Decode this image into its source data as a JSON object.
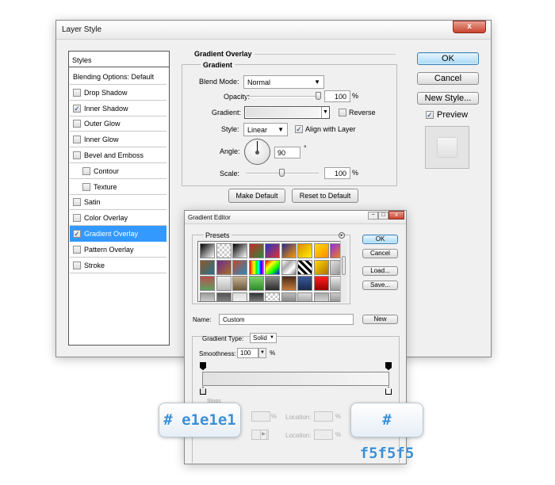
{
  "layer_style": {
    "title": "Layer Style",
    "close": "x",
    "styles_header": "Styles",
    "items": [
      {
        "label": "Blending Options: Default",
        "checkbox": false,
        "checked": false,
        "active": false
      },
      {
        "label": "Drop Shadow",
        "checkbox": true,
        "checked": false,
        "active": false
      },
      {
        "label": "Inner Shadow",
        "checkbox": true,
        "checked": true,
        "active": false
      },
      {
        "label": "Outer Glow",
        "checkbox": true,
        "checked": false,
        "active": false
      },
      {
        "label": "Inner Glow",
        "checkbox": true,
        "checked": false,
        "active": false
      },
      {
        "label": "Bevel and Emboss",
        "checkbox": true,
        "checked": false,
        "active": false
      },
      {
        "label": "Contour",
        "checkbox": true,
        "checked": false,
        "active": false,
        "indent": true
      },
      {
        "label": "Texture",
        "checkbox": true,
        "checked": false,
        "active": false,
        "indent": true
      },
      {
        "label": "Satin",
        "checkbox": true,
        "checked": false,
        "active": false
      },
      {
        "label": "Color Overlay",
        "checkbox": true,
        "checked": false,
        "active": false
      },
      {
        "label": "Gradient Overlay",
        "checkbox": true,
        "checked": true,
        "active": true
      },
      {
        "label": "Pattern Overlay",
        "checkbox": true,
        "checked": false,
        "active": false
      },
      {
        "label": "Stroke",
        "checkbox": true,
        "checked": false,
        "active": false
      }
    ],
    "section_title": "Gradient Overlay",
    "group_title": "Gradient",
    "blend_mode_label": "Blend Mode:",
    "blend_mode_value": "Normal",
    "opacity_label": "Opacity:",
    "opacity_value": "100",
    "opacity_level": 1.0,
    "percent": "%",
    "gradient_label": "Gradient:",
    "reverse_label": "Reverse",
    "reverse_checked": false,
    "style_label": "Style:",
    "style_value": "Linear",
    "align_label": "Align with Layer",
    "align_checked": true,
    "angle_label": "Angle:",
    "angle_value": "90",
    "degree": "°",
    "scale_label": "Scale:",
    "scale_value": "100",
    "scale_level": 0.5,
    "make_default": "Make Default",
    "reset_default": "Reset to Default",
    "ok": "OK",
    "cancel": "Cancel",
    "new_style": "New Style...",
    "preview_label": "Preview",
    "preview_checked": true
  },
  "gradient_editor": {
    "title": "Gradient Editor",
    "presets_label": "Presets",
    "ok": "OK",
    "cancel": "Cancel",
    "load": "Load...",
    "save": "Save...",
    "name_label": "Name:",
    "name_value": "Custom",
    "new_button": "New",
    "type_label": "Gradient Type:",
    "type_value": "Solid",
    "smoothness_label": "Smoothness:",
    "smoothness_value": "100",
    "percent": "%",
    "stops_label": "Stops",
    "location_label": "Location:",
    "location_label_2": "Location:",
    "pct_1": "%",
    "pct_2": "%",
    "pct_3": "%",
    "gradient_start": "#e1e1e1",
    "gradient_end": "#f5f5f5"
  },
  "annotations": {
    "left_color": "# e1e1e1",
    "right_color": "# f5f5f5"
  }
}
